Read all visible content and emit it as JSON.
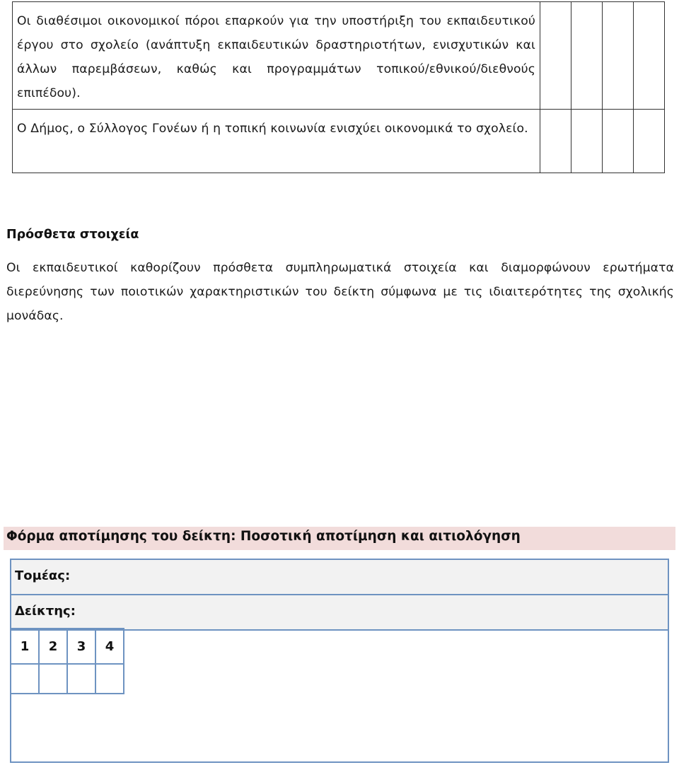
{
  "criteria_table": {
    "rows": [
      {
        "text": "Οι διαθέσιμοι οικονομικοί πόροι επαρκούν για την υποστήριξη του εκπαιδευτικού έργου στο σχολείο (ανάπτυξη εκπαιδευτικών δραστηριοτήτων, ενισχυτικών και άλλων παρεμβάσεων, καθώς και προγραμμάτων τοπικού/εθνικού/διεθνούς επιπέδου).",
        "ratings": [
          "",
          "",
          "",
          ""
        ]
      },
      {
        "text": "Ο Δήμος, ο Σύλλογος Γονέων ή η τοπική κοινωνία ενισχύει οικονομικά το σχολείο.",
        "ratings": [
          "",
          "",
          "",
          ""
        ]
      }
    ]
  },
  "additional": {
    "title": "Πρόσθετα στοιχεία",
    "body": "Οι εκπαιδευτικοί καθορίζουν πρόσθετα συμπληρωματικά στοιχεία και διαμορφώνουν ερωτήματα διερεύνησης των ποιοτικών χαρακτηριστικών του δείκτη σύμφωνα  με τις ιδιαιτερότητες της σχολικής μονάδας."
  },
  "form": {
    "heading": "Φόρμα αποτίμησης του δείκτη: Ποσοτική αποτίμηση και αιτιολόγηση",
    "heading_bg": "#f2dcdb",
    "border_color": "#6e93c1",
    "sector_label": "Τομέας:",
    "indicator_label": "Δείκτης:",
    "score_headers": [
      "1",
      "2",
      "3",
      "4"
    ],
    "score_values": [
      "",
      "",
      "",
      ""
    ],
    "justification": ""
  }
}
